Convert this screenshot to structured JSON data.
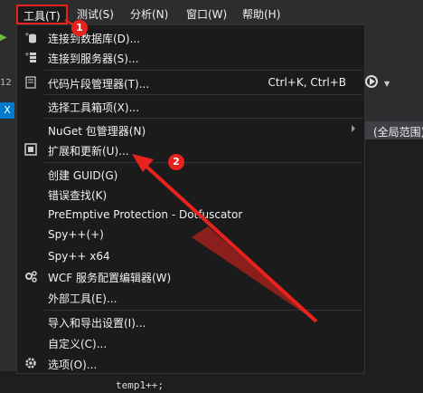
{
  "menubar": {
    "items": [
      {
        "label": "工具(T)"
      },
      {
        "label": "测试(S)"
      },
      {
        "label": "分析(N)"
      },
      {
        "label": "窗口(W)"
      },
      {
        "label": "帮助(H)"
      }
    ]
  },
  "annotations": {
    "badge1": "1",
    "badge2": "2",
    "accent_color": "#e8231e"
  },
  "background": {
    "code_text": "temp1++;",
    "scope_label": "(全局范围)",
    "close_tab_glyph": "X",
    "line_fragment": "12"
  },
  "dropdown": {
    "items": [
      {
        "label": "连接到数据库(D)...",
        "icon": "database-connect-icon"
      },
      {
        "label": "连接到服务器(S)...",
        "icon": "server-connect-icon"
      },
      {
        "label": "代码片段管理器(T)...",
        "shortcut": "Ctrl+K, Ctrl+B",
        "icon": "snippet-manager-icon"
      },
      {
        "label": "选择工具箱项(X)..."
      },
      {
        "label": "NuGet 包管理器(N)",
        "has_submenu": true
      },
      {
        "label": "扩展和更新(U)...",
        "icon": "extensions-icon"
      },
      {
        "label": "创建 GUID(G)"
      },
      {
        "label": "错误查找(K)"
      },
      {
        "label": "PreEmptive Protection - Dotfuscator"
      },
      {
        "label": "Spy++(+)"
      },
      {
        "label": "Spy++ x64"
      },
      {
        "label": "WCF 服务配置编辑器(W)",
        "icon": "wcf-gears-icon"
      },
      {
        "label": "外部工具(E)..."
      },
      {
        "label": "导入和导出设置(I)..."
      },
      {
        "label": "自定义(C)..."
      },
      {
        "label": "选项(O)...",
        "icon": "options-gear-icon"
      }
    ]
  }
}
